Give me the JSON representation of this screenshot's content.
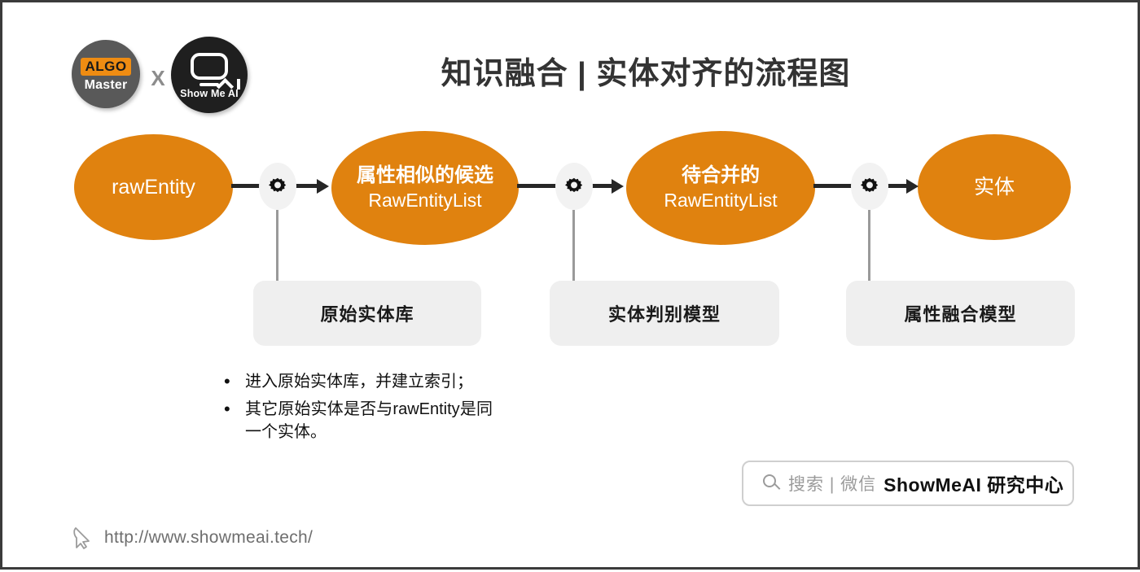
{
  "slide": {
    "title": "知识融合 | 实体对齐的流程图"
  },
  "branding": {
    "algo_badge": "ALGO",
    "algo_master": "Master",
    "cross": "X",
    "showmeai": "Show Me AI"
  },
  "flow": {
    "nodes": [
      {
        "cn": "",
        "en": "rawEntity",
        "solo": true
      },
      {
        "cn": "属性相似的候选",
        "en": "RawEntityList",
        "solo": false
      },
      {
        "cn": "待合并的",
        "en": "RawEntityList",
        "solo": false
      },
      {
        "cn": "实体",
        "en": "",
        "solo": true
      }
    ],
    "connector_icon": "gear-icon",
    "stages": [
      {
        "label": "原始实体库"
      },
      {
        "label": "实体判别模型"
      },
      {
        "label": "属性融合模型"
      }
    ]
  },
  "bullets": [
    {
      "marker": "•",
      "text": "进入原始实体库，并建立索引；"
    },
    {
      "marker": "•",
      "text": "其它原始实体是否与rawEntity是同一个实体。"
    }
  ],
  "search": {
    "icon": "search-icon",
    "gray_text": "搜索 | 微信",
    "bold_text": "ShowMeAI 研究中心"
  },
  "footer": {
    "icon": "cursor-icon",
    "url": "http://www.showmeai.tech/"
  },
  "colors": {
    "accent_orange": "#E0820F",
    "box_gray": "#EFEFEF",
    "line_dark": "#262626",
    "line_gray": "#9A9A9A",
    "title_text": "#333333"
  }
}
